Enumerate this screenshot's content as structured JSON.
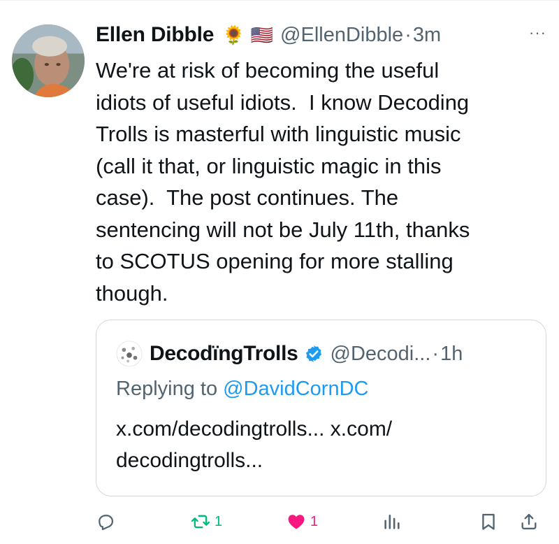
{
  "post": {
    "author_name": "Ellen Dibble",
    "author_emojis": [
      "🌻",
      "🇺🇸"
    ],
    "handle": "@EllenDibble",
    "separator": "·",
    "time": "3m",
    "more_label": "···",
    "text": "We're at risk of becoming the useful\nidiots of useful idiots.  I know Decoding\nTrolls is masterful with linguistic music\n(call it that, or linguistic magic in this\ncase).  The post continues. The\nsentencing will not be July 11th, thanks\nto SCOTUS opening for more stalling\nthough."
  },
  "quote": {
    "author_name": "DecodïngTrolls",
    "handle": "@Decodi...",
    "separator": "·",
    "time": "1h",
    "replying_to_prefix": "Replying to ",
    "replying_to_handle": "@DavidCornDC",
    "text": "x.com/decodingtrolls... x.com/\ndecodingtrolls..."
  },
  "actions": {
    "reply_count": "",
    "repost_count": "1",
    "like_count": "1",
    "views_count": ""
  },
  "icons": {
    "more": "more-dots-icon",
    "verified": "verified-badge-icon",
    "reply": "reply-icon",
    "repost": "repost-icon",
    "like": "heart-icon",
    "views": "views-icon",
    "bookmark": "bookmark-icon",
    "share": "share-icon"
  },
  "colors": {
    "text": "#0f1419",
    "secondary": "#536471",
    "accent_blue": "#1d9bf0",
    "repost_green": "#00ba7c",
    "like_pink": "#f91880",
    "border": "#cfd9de"
  }
}
